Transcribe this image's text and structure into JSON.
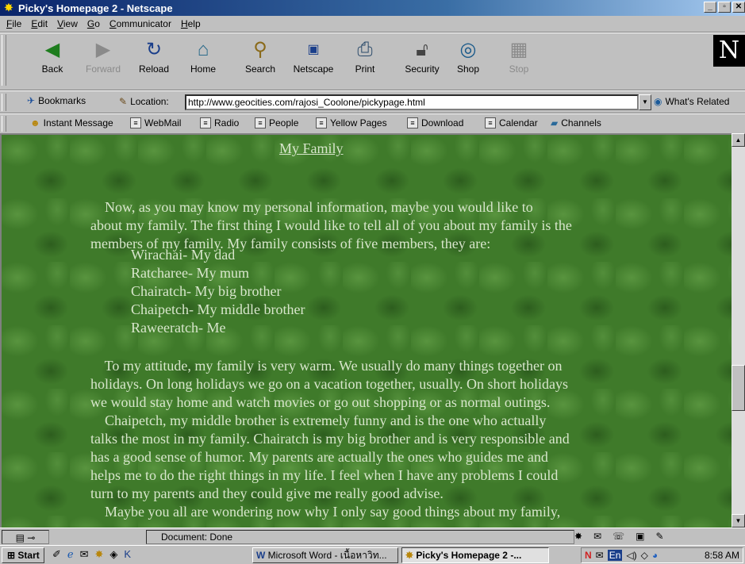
{
  "window": {
    "title": "Picky's Homepage 2 - Netscape",
    "app_icon": "netscape-window-icon",
    "controls": [
      "_",
      "▫",
      "✕"
    ]
  },
  "menu": [
    {
      "pre": "",
      "u": "F",
      "post": "ile"
    },
    {
      "pre": "",
      "u": "E",
      "post": "dit"
    },
    {
      "pre": "",
      "u": "V",
      "post": "iew"
    },
    {
      "pre": "",
      "u": "G",
      "post": "o"
    },
    {
      "pre": "",
      "u": "C",
      "post": "ommunicator"
    },
    {
      "pre": "",
      "u": "H",
      "post": "elp"
    }
  ],
  "nav": {
    "back": "Back",
    "forward": "Forward",
    "reload": "Reload",
    "home": "Home",
    "search": "Search",
    "netscape": "Netscape",
    "print": "Print",
    "security": "Security",
    "shop": "Shop",
    "stop": "Stop"
  },
  "location": {
    "bookmarks": "Bookmarks",
    "label": "Location:",
    "url": "http://www.geocities.com/rajosi_Coolone/pickypage.html",
    "related": "What's Related"
  },
  "personal": {
    "instant_message": "Instant Message",
    "webmail": "WebMail",
    "radio": "Radio",
    "people": "People",
    "yellow_pages": "Yellow Pages",
    "download": "Download",
    "calendar": "Calendar",
    "channels": "Channels"
  },
  "page": {
    "title": "My Family",
    "intro": [
      "    Now, as you may know my personal information, maybe you would like to",
      "about my family. The first thing I would like to tell all of you about my family is the",
      "members of my family. My family consists of five members, they are:"
    ],
    "members": [
      "Wirachai- My dad",
      "Ratcharee- My mum",
      "Chairatch- My big brother",
      "Chaipetch- My middle brother",
      "Raweeratch- Me"
    ],
    "body": [
      "    To my attitude, my family is very warm. We usually do many things together on",
      "holidays. On long holidays we go on a vacation together, usually. On short holidays",
      "we would stay home and watch movies or go out shopping or as normal outings.",
      "    Chaipetch, my middle brother is extremely funny and is the one who actually",
      "talks the most in my family. Chairatch is my big brother and is very responsible and",
      "has a good sense of humor. My parents are actually the ones who guides me and",
      "helps me to do the right things in my life. I feel when I have any problems I could",
      "turn to my parents and they could give me really good advise.",
      "    Maybe you all are wondering now why I only say good things about my family,"
    ]
  },
  "status": {
    "text": "Document: Done"
  },
  "taskbar": {
    "start": "Start",
    "tasks": [
      "Microsoft Word - เนื้อหาวิท...",
      "Picky's Homepage 2 -..."
    ],
    "tray_lang": "En",
    "clock": "8:58 AM"
  }
}
